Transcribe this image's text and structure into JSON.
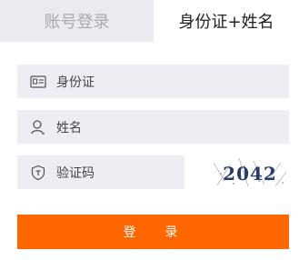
{
  "tabs": [
    {
      "label": "账号登录",
      "active": false
    },
    {
      "label": "身份证+姓名",
      "active": true
    }
  ],
  "form": {
    "id_card_placeholder": "身份证",
    "name_placeholder": "姓名",
    "captcha_placeholder": "验证码",
    "captcha_text": "2042"
  },
  "login_button_label": "登 录",
  "colors": {
    "accent": "#ff6600",
    "field_bg": "#eeedf3",
    "inactive_tab_bg": "#ebeaef"
  },
  "icons": [
    "id-card-icon",
    "user-icon",
    "shield-icon"
  ]
}
